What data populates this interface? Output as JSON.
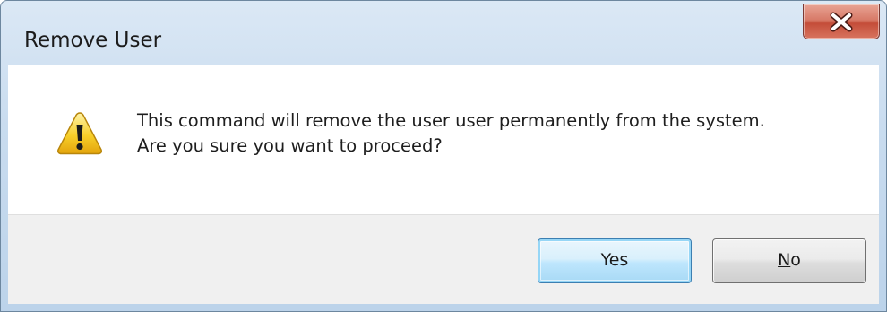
{
  "dialog": {
    "title": "Remove User",
    "close_icon": "close-icon",
    "icon": "warning-icon",
    "message_line1": "This command will remove the user user permanently from the system.",
    "message_line2": "Are you sure you want to proceed?"
  },
  "buttons": {
    "yes_label": "Yes",
    "no_mnemonic": "N",
    "no_rest": "o"
  },
  "colors": {
    "accent": "#3c7fb1",
    "close_button": "#c44d39",
    "warning_yellow": "#f5c518",
    "footer_bg": "#f0f0f0"
  }
}
